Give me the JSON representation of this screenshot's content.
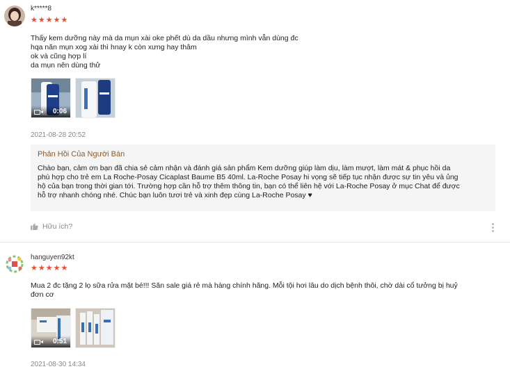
{
  "reviews": [
    {
      "username": "k*****8",
      "stars": "★★★★★",
      "rating": 5,
      "comment_lines": [
        "Thấy kem dưỡng này mà da mụn xài oke phết dù da dầu nhưng mình vẫn dùng đc",
        "hqa năn mụn xog xài thì hnay k còn xưng hay thâm",
        "ok và cũng hợp lí",
        "da mụn nên dùng thử"
      ],
      "media": [
        {
          "type": "video",
          "duration": "0:06"
        },
        {
          "type": "image"
        }
      ],
      "date": "2021-08-28 20:52",
      "seller_reply": {
        "title": "Phản Hồi Của Người Bán",
        "lines": [
          "Chào bạn, cảm ơn bạn đã chia sẻ cảm nhận và đánh giá sản phẩm Kem dưỡng giúp làm dịu, làm mượt, làm mát & phục hồi da",
          "phù hợp cho trẻ em La Roche-Posay Cicaplast Baume B5 40ml. La-Roche Posay hi vọng sẽ tiếp tục nhận được sự tin yêu và ủng",
          "hộ của bạn trong thời gian tới. Trường hợp cần hỗ trợ thêm thông tin, bạn có thể liên hệ với La-Roche Posay ở mục Chat để được",
          "hỗ trợ nhanh chóng nhé. Chúc bạn luôn tươi trẻ và xinh đẹp cùng La-Roche Posay ♥"
        ]
      },
      "helpful_label": "Hữu ích?"
    },
    {
      "username": "hanguyen92kt",
      "stars": "★★★★★",
      "rating": 5,
      "comment_lines": [
        "Mua 2 đc tặng 2 lọ sữa rửa mặt bé!!! Săn sale giá rẻ mà hàng chính hãng. Mỗi tội hơi lâu do dịch bệnh thôi, chờ dài cổ tưởng bị huỷ",
        "đơn cơ"
      ],
      "media": [
        {
          "type": "video",
          "duration": "0:51"
        },
        {
          "type": "image"
        }
      ],
      "date": "2021-08-30 14:34"
    }
  ],
  "colors": {
    "star": "#ee4d2d",
    "seller_title": "#8b5a2b",
    "seller_bg": "#f5f5f5",
    "muted": "#888888"
  },
  "icons": {
    "helpful": "thumbs-up-icon",
    "more": "more-vertical-icon",
    "video": "video-camera-icon"
  }
}
